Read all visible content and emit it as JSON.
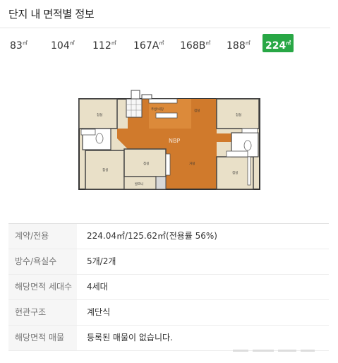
{
  "header": {
    "title": "단지 내 면적별 정보"
  },
  "tabs": [
    {
      "num": "83",
      "suffix": "",
      "unit": "㎡",
      "active": false
    },
    {
      "num": "104",
      "suffix": "",
      "unit": "㎡",
      "active": false
    },
    {
      "num": "112",
      "suffix": "",
      "unit": "㎡",
      "active": false
    },
    {
      "num": "167",
      "suffix": "A",
      "unit": "㎡",
      "active": false
    },
    {
      "num": "168",
      "suffix": "B",
      "unit": "㎡",
      "active": false
    },
    {
      "num": "188",
      "suffix": "",
      "unit": "㎡",
      "active": false
    },
    {
      "num": "224",
      "suffix": "",
      "unit": "㎡",
      "active": true
    }
  ],
  "floorplan": {
    "watermark": "NBP",
    "rooms": [
      "침실",
      "침실",
      "주방/식당",
      "침실",
      "침실",
      "거실",
      "침실",
      "침실",
      "발코니"
    ]
  },
  "info": [
    {
      "label": "계약/전용",
      "value": "224.04㎡/125.62㎡(전용률 56%)"
    },
    {
      "label": "방수/욕실수",
      "value": "5개/2개"
    },
    {
      "label": "해당면적 세대수",
      "value": "4세대"
    },
    {
      "label": "현관구조",
      "value": "계단식"
    },
    {
      "label": "해당면적 매물",
      "value": "등록된 매물이 없습니다."
    }
  ],
  "colors": {
    "active_tab": "#28a745",
    "wood_floor": "#d07a2c",
    "room_floor": "#e9e0c8"
  }
}
